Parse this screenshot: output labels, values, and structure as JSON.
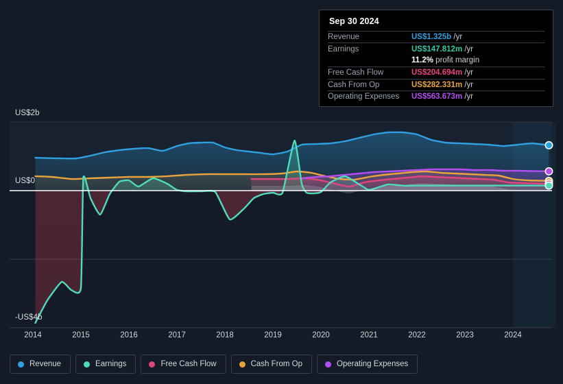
{
  "axes": {
    "y_top_label": "US$2b",
    "y_zero_label": "US$0",
    "y_bottom_label": "-US$4b",
    "x_labels": [
      "2014",
      "2015",
      "2016",
      "2017",
      "2018",
      "2019",
      "2020",
      "2021",
      "2022",
      "2023",
      "2024"
    ]
  },
  "tooltip": {
    "date": "Sep 30 2024",
    "rows": [
      {
        "name": "Revenue",
        "value": "US$1.325b",
        "unit": "/yr",
        "color": "#2f9fe0"
      },
      {
        "name": "Earnings",
        "value": "US$147.812m",
        "unit": "/yr",
        "color": "#33c9a8"
      },
      {
        "name": "",
        "value": "11.2%",
        "unit": "profit margin",
        "color": "#ffffff"
      },
      {
        "name": "Free Cash Flow",
        "value": "US$204.694m",
        "unit": "/yr",
        "color": "#e8437f"
      },
      {
        "name": "Cash From Op",
        "value": "US$282.331m",
        "unit": "/yr",
        "color": "#e8a33d"
      },
      {
        "name": "Operating Expenses",
        "value": "US$563.673m",
        "unit": "/yr",
        "color": "#b44df0"
      }
    ]
  },
  "legend": [
    {
      "label": "Revenue",
      "color": "#2f9fe0"
    },
    {
      "label": "Earnings",
      "color": "#4fdcba"
    },
    {
      "label": "Free Cash Flow",
      "color": "#e0467e"
    },
    {
      "label": "Cash From Op",
      "color": "#e8a33d"
    },
    {
      "label": "Operating Expenses",
      "color": "#b44df0"
    }
  ],
  "chart_data": {
    "type": "line",
    "title": "",
    "xlabel": "",
    "ylabel": "US$",
    "xlim": [
      2013.75,
      2024.9
    ],
    "ylim": [
      -4.4,
      2.4
    ],
    "grid": true,
    "y_ticks": [
      2,
      0,
      -2,
      -4
    ],
    "y_tick_labels": [
      "US$2b",
      "US$0",
      "",
      "-US$4b"
    ],
    "x_ticks": [
      2014,
      2015,
      2016,
      2017,
      2018,
      2019,
      2020,
      2021,
      2022,
      2023,
      2024
    ],
    "legend_position": "bottom",
    "units": "billions of US$ per year",
    "highlight_band": {
      "from": 2024.0,
      "to": 2024.9,
      "note": "latest reported period"
    },
    "series": [
      {
        "name": "Revenue",
        "color": "#2f9fe0",
        "x": [
          2014.05,
          2014.3,
          2014.6,
          2014.9,
          2015.2,
          2015.5,
          2015.8,
          2016.1,
          2016.4,
          2016.7,
          2017.0,
          2017.25,
          2017.5,
          2017.75,
          2018.0,
          2018.25,
          2018.5,
          2018.75,
          2019.0,
          2019.3,
          2019.6,
          2019.9,
          2020.2,
          2020.5,
          2020.8,
          2021.1,
          2021.4,
          2021.7,
          2022.0,
          2022.3,
          2022.6,
          2022.9,
          2023.2,
          2023.5,
          2023.8,
          2024.1,
          2024.4,
          2024.75
        ],
        "y": [
          0.96,
          0.95,
          0.94,
          0.94,
          1.02,
          1.12,
          1.18,
          1.22,
          1.24,
          1.16,
          1.3,
          1.38,
          1.4,
          1.4,
          1.26,
          1.18,
          1.14,
          1.1,
          1.06,
          1.14,
          1.34,
          1.36,
          1.38,
          1.44,
          1.54,
          1.64,
          1.7,
          1.7,
          1.64,
          1.48,
          1.4,
          1.38,
          1.36,
          1.34,
          1.3,
          1.34,
          1.38,
          1.325
        ]
      },
      {
        "name": "Earnings",
        "color": "#4fdcba",
        "x": [
          2014.05,
          2014.3,
          2014.6,
          2014.8,
          2015.0,
          2015.05,
          2015.2,
          2015.4,
          2015.6,
          2015.8,
          2016.0,
          2016.2,
          2016.5,
          2016.8,
          2017.0,
          2017.2,
          2017.5,
          2017.8,
          2018.1,
          2018.4,
          2018.6,
          2018.8,
          2019.0,
          2019.2,
          2019.45,
          2019.6,
          2019.7,
          2019.85,
          2020.0,
          2020.2,
          2020.5,
          2020.8,
          2021.0,
          2021.2,
          2021.4,
          2021.6,
          2021.8,
          2022.0,
          2024.75
        ],
        "y": [
          -3.86,
          -3.2,
          -2.66,
          -2.9,
          -2.84,
          0.38,
          -0.22,
          -0.7,
          -0.1,
          0.26,
          0.3,
          0.12,
          0.36,
          0.2,
          0.02,
          -0.02,
          -0.02,
          -0.04,
          -0.84,
          -0.52,
          -0.22,
          -0.1,
          -0.06,
          -0.06,
          1.46,
          0.2,
          -0.06,
          -0.08,
          -0.04,
          0.24,
          0.42,
          0.18,
          0.02,
          0.1,
          0.18,
          0.16,
          0.14,
          0.148,
          0.1478
        ]
      },
      {
        "name": "Free Cash Flow",
        "color": "#e0467e",
        "x": [
          2018.55,
          2018.9,
          2019.3,
          2019.7,
          2020.0,
          2020.3,
          2020.6,
          2020.9,
          2021.2,
          2021.5,
          2021.8,
          2022.1,
          2022.4,
          2022.7,
          2023.0,
          2023.3,
          2023.6,
          2023.9,
          2024.2,
          2024.75
        ],
        "y": [
          0.34,
          0.34,
          0.34,
          0.36,
          0.3,
          0.2,
          0.12,
          0.24,
          0.3,
          0.34,
          0.38,
          0.42,
          0.4,
          0.38,
          0.36,
          0.34,
          0.32,
          0.24,
          0.22,
          0.2047
        ]
      },
      {
        "name": "Cash From Op",
        "color": "#e8a33d",
        "x": [
          2014.05,
          2014.4,
          2014.8,
          2015.2,
          2015.6,
          2016.0,
          2016.4,
          2016.8,
          2017.2,
          2017.6,
          2018.0,
          2018.4,
          2018.8,
          2019.2,
          2019.5,
          2019.8,
          2020.1,
          2020.4,
          2020.7,
          2021.0,
          2021.3,
          2021.6,
          2021.9,
          2022.2,
          2022.5,
          2022.8,
          2023.1,
          2023.4,
          2023.7,
          2024.0,
          2024.3,
          2024.75
        ],
        "y": [
          0.42,
          0.4,
          0.34,
          0.36,
          0.38,
          0.4,
          0.4,
          0.42,
          0.46,
          0.48,
          0.48,
          0.48,
          0.48,
          0.5,
          0.56,
          0.52,
          0.42,
          0.34,
          0.32,
          0.4,
          0.46,
          0.5,
          0.54,
          0.56,
          0.52,
          0.5,
          0.48,
          0.46,
          0.44,
          0.34,
          0.3,
          0.2823
        ]
      },
      {
        "name": "Operating Expenses",
        "color": "#b44df0",
        "x": [
          2019.6,
          2019.9,
          2020.2,
          2020.5,
          2020.8,
          2021.1,
          2021.4,
          2021.7,
          2022.0,
          2022.3,
          2022.6,
          2022.9,
          2023.2,
          2023.5,
          2023.8,
          2024.1,
          2024.4,
          2024.75
        ],
        "y": [
          0.36,
          0.4,
          0.42,
          0.46,
          0.5,
          0.54,
          0.56,
          0.58,
          0.6,
          0.62,
          0.62,
          0.62,
          0.6,
          0.6,
          0.58,
          0.58,
          0.57,
          0.5637
        ]
      }
    ],
    "end_markers": [
      {
        "series": "Revenue",
        "x": 2024.75,
        "y": 1.325
      },
      {
        "series": "Operating Expenses",
        "x": 2024.75,
        "y": 0.5637
      },
      {
        "series": "Cash From Op",
        "x": 2024.75,
        "y": 0.2823
      },
      {
        "series": "Free Cash Flow",
        "x": 2024.75,
        "y": 0.2047
      },
      {
        "series": "Earnings",
        "x": 2024.75,
        "y": 0.1478
      }
    ]
  }
}
